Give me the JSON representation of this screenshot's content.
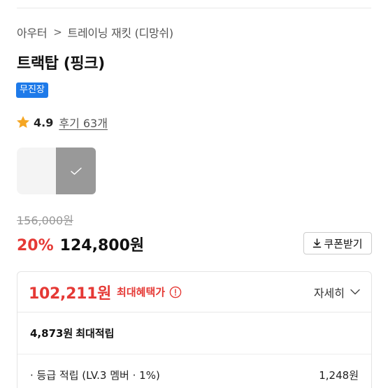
{
  "breadcrumb": {
    "category": "아우터",
    "separator": ">",
    "subcategory": "트레이닝 재킷 (디망쉬)"
  },
  "product": {
    "title": "트랙탑 (핑크)",
    "badge": "무진장",
    "rating": "4.9",
    "review_link": "후기 63개"
  },
  "options": {
    "swatches": [
      {
        "name": "white",
        "color": "#f4f4f4",
        "selected": false
      },
      {
        "name": "selected",
        "color": "#999999",
        "selected": true
      }
    ]
  },
  "pricing": {
    "original_price": "156,000원",
    "discount_rate": "20%",
    "sale_price": "124,800원",
    "coupon_button": "쿠폰받기"
  },
  "benefit": {
    "best_price": "102,211원",
    "best_label": "최대혜택가",
    "detail_label": "자세히",
    "points_amount": "4,873원",
    "points_label": "최대적립",
    "grade_label": "· 등급 적립 (LV.3 멤버 · 1%)",
    "grade_amount": "1,248원"
  },
  "colors": {
    "accent_red": "#e53935",
    "badge_blue": "#1e7ae9",
    "star": "#f5a623"
  }
}
